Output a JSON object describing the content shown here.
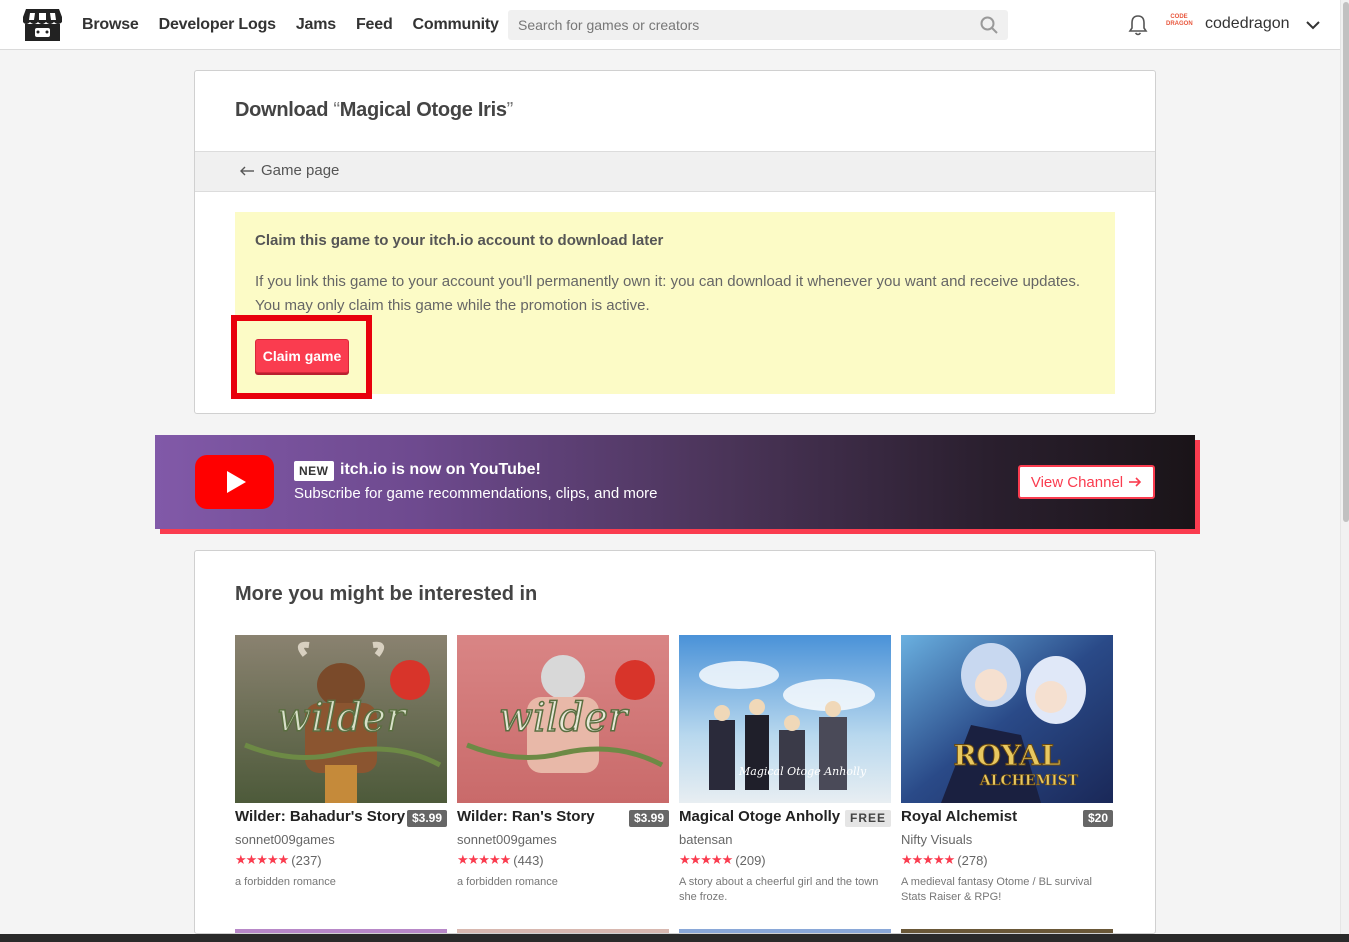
{
  "header": {
    "nav": [
      "Browse",
      "Developer Logs",
      "Jams",
      "Feed",
      "Community"
    ],
    "search_placeholder": "Search for games or creators",
    "username": "codedragon",
    "avatar_text": "CODE DRAGON"
  },
  "download": {
    "title_prefix": "Download ",
    "open_quote": "“",
    "game_name": "Magical Otoge Iris",
    "close_quote": "”",
    "back_label": "Game page",
    "claim_title": "Claim this game to your itch.io account to download later",
    "claim_text": "If you link this game to your account you'll permanently own it: you can download it whenever you want and receive updates. You may only claim this game while the promotion is active.",
    "claim_button": "Claim game"
  },
  "youtube": {
    "badge": "NEW",
    "headline": "itch.io is now on YouTube!",
    "subtitle": "Subscribe for game recommendations, clips, and more",
    "button": "View Channel"
  },
  "recommendations": {
    "title": "More you might be interested in",
    "games": [
      {
        "title": "Wilder: Bahadur's Story",
        "price": "$3.99",
        "author": "sonnet009games",
        "stars": "★★★★★",
        "count": "(237)",
        "desc": "a forbidden romance"
      },
      {
        "title": "Wilder: Ran's Story",
        "price": "$3.99",
        "author": "sonnet009games",
        "stars": "★★★★★",
        "count": "(443)",
        "desc": "a forbidden romance"
      },
      {
        "title": "Magical Otoge Anholly",
        "price": "FREE",
        "author": "batensan",
        "stars": "★★★★★",
        "count": "(209)",
        "desc": "A story about a cheerful girl and the town she froze."
      },
      {
        "title": "Royal Alchemist",
        "price": "$20",
        "author": "Nifty Visuals",
        "stars": "★★★★★",
        "count": "(278)",
        "desc": "A medieval fantasy Otome / BL survival Stats Raiser & RPG!"
      }
    ]
  },
  "colors": {
    "accent": "#fa3c4f",
    "highlight": "#e8000c",
    "claim_bg": "#fcfbc6"
  }
}
